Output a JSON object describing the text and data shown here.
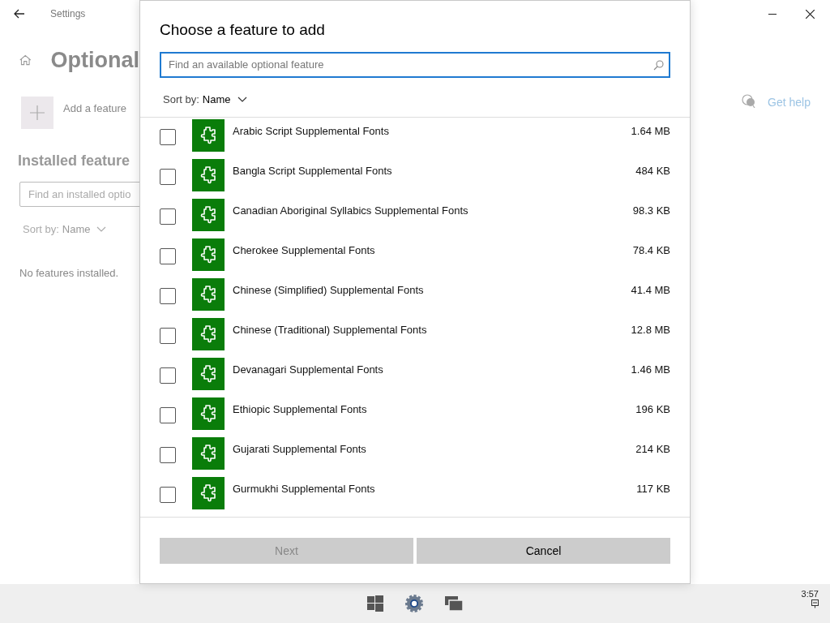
{
  "window": {
    "title": "Settings"
  },
  "page": {
    "heading": "Optional",
    "add_feature": "Add a feature",
    "installed_heading": "Installed feature",
    "installed_search": {
      "placeholder": "Find an installed optio"
    },
    "sort_label": "Sort by:",
    "sort_value": "Name",
    "empty_message": "No features installed.",
    "help_link": "Get help"
  },
  "dialog": {
    "title": "Choose a feature to add",
    "search": {
      "placeholder": "Find an available optional feature"
    },
    "sort_label": "Sort by:",
    "sort_value": "Name",
    "features": [
      {
        "name": "Arabic Script Supplemental Fonts",
        "size": "1.64 MB",
        "checked": false
      },
      {
        "name": "Bangla Script Supplemental Fonts",
        "size": "484 KB",
        "checked": false
      },
      {
        "name": "Canadian Aboriginal Syllabics Supplemental Fonts",
        "size": "98.3 KB",
        "checked": false
      },
      {
        "name": "Cherokee Supplemental Fonts",
        "size": "78.4 KB",
        "checked": false
      },
      {
        "name": "Chinese (Simplified) Supplemental Fonts",
        "size": "41.4 MB",
        "checked": false
      },
      {
        "name": "Chinese (Traditional) Supplemental Fonts",
        "size": "12.8 MB",
        "checked": false
      },
      {
        "name": "Devanagari Supplemental Fonts",
        "size": "1.46 MB",
        "checked": false
      },
      {
        "name": "Ethiopic Supplemental Fonts",
        "size": "196 KB",
        "checked": false
      },
      {
        "name": "Gujarati Supplemental Fonts",
        "size": "214 KB",
        "checked": false
      },
      {
        "name": "Gurmukhi Supplemental Fonts",
        "size": "117 KB",
        "checked": false
      }
    ],
    "buttons": [
      {
        "label": "Next",
        "disabled": true
      },
      {
        "label": "Cancel",
        "disabled": false
      }
    ]
  },
  "taskbar": {
    "clock": "3:57"
  }
}
